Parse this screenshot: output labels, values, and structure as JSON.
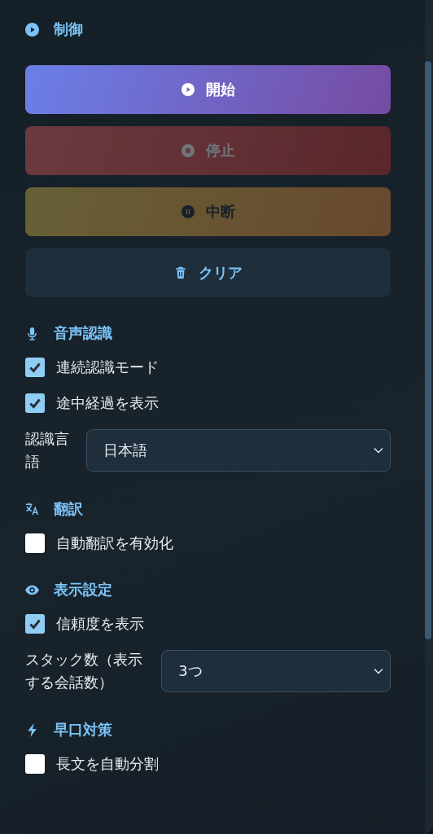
{
  "sections": [
    {
      "kind": "control",
      "title": "制御",
      "buttons": [
        {
          "kind": "start",
          "label": "開始",
          "disabled": false
        },
        {
          "kind": "stop",
          "label": "停止",
          "disabled": true
        },
        {
          "kind": "pause",
          "label": "中断",
          "disabled": true
        },
        {
          "kind": "clear",
          "label": "クリア",
          "disabled": false
        }
      ]
    },
    {
      "kind": "speech",
      "title": "音声認識",
      "items": [
        {
          "kind": "checkbox",
          "label": "連続認識モード",
          "checked": true
        },
        {
          "kind": "checkbox",
          "label": "途中経過を表示",
          "checked": true
        },
        {
          "kind": "select",
          "label": "認識言語",
          "value": "日本語"
        }
      ]
    },
    {
      "kind": "translate",
      "title": "翻訳",
      "items": [
        {
          "kind": "checkbox",
          "label": "自動翻訳を有効化",
          "checked": false
        }
      ]
    },
    {
      "kind": "display",
      "title": "表示設定",
      "items": [
        {
          "kind": "checkbox",
          "label": "信頼度を表示",
          "checked": true
        },
        {
          "kind": "select",
          "label": "スタック数（表示する会話数）",
          "value": "3つ"
        }
      ]
    },
    {
      "kind": "speed",
      "title": "早口対策",
      "items": [
        {
          "kind": "checkbox",
          "label": "長文を自動分割",
          "checked": false
        }
      ]
    }
  ]
}
